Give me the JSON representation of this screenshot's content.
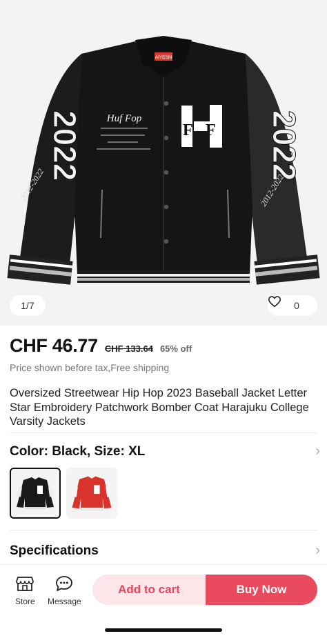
{
  "gallery": {
    "counter": "1/7",
    "favorite_count": "0",
    "jacket_texts": {
      "label": "AIYESM",
      "chest_script": "Huf Fop",
      "sleeve_number": "2022",
      "sleeve_script": "2012-2022"
    }
  },
  "price": {
    "current": "CHF 46.77",
    "original": "CHF 133.64",
    "discount": "65% off",
    "note": "Price shown before tax,Free shipping"
  },
  "product": {
    "title": "Oversized Streetwear Hip Hop 2023 Baseball Jacket Letter Star Embroidery Patchwork Bomber Coat Harajuku College Varsity Jackets"
  },
  "variant": {
    "label": "Color: Black, Size: XL",
    "options": [
      {
        "name": "Black",
        "color": "#1a1a1a",
        "selected": true
      },
      {
        "name": "Red",
        "color": "#d9342b",
        "selected": false
      }
    ]
  },
  "specifications": {
    "label": "Specifications"
  },
  "bottom_bar": {
    "store_label": "Store",
    "message_label": "Message",
    "add_to_cart_label": "Add to cart",
    "buy_now_label": "Buy Now"
  },
  "colors": {
    "accent": "#ea4a5d",
    "accent_light": "#fde6ea"
  }
}
